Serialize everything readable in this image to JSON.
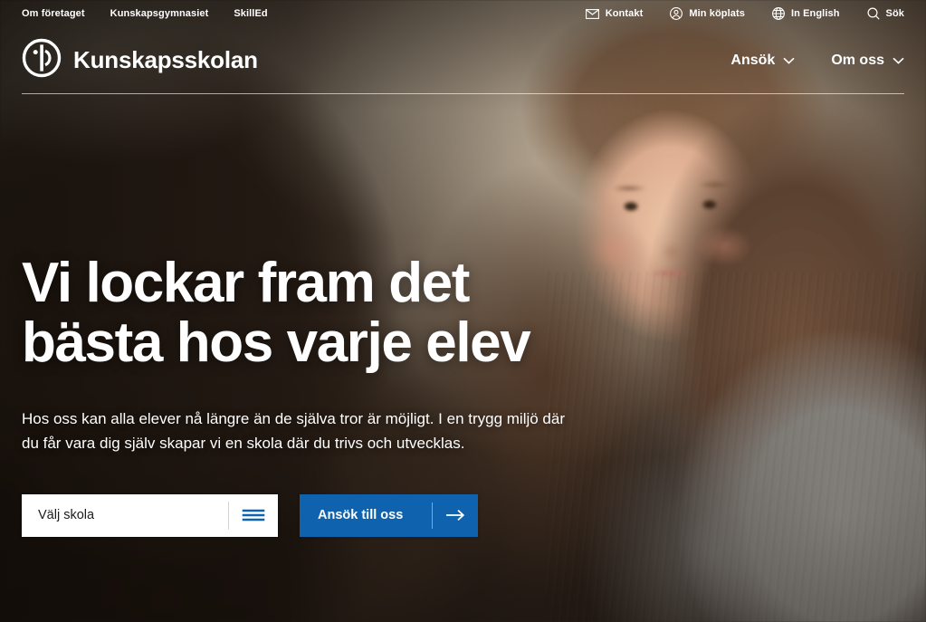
{
  "brand": {
    "name": "Kunskapsskolan",
    "logo_icon": "kunskapsskolan-circle-logo-icon"
  },
  "utility_bar": {
    "left_links": [
      {
        "label": "Om företaget"
      },
      {
        "label": "Kunskapsgymnasiet"
      },
      {
        "label": "SkillEd"
      }
    ],
    "right_links": [
      {
        "label": "Kontakt",
        "icon": "envelope-icon"
      },
      {
        "label": "Min köplats",
        "icon": "user-circle-icon"
      },
      {
        "label": "In English",
        "icon": "globe-icon"
      },
      {
        "label": "Sök",
        "icon": "search-icon"
      }
    ]
  },
  "main_nav": {
    "items": [
      {
        "label": "Ansök",
        "icon": "chevron-down-icon"
      },
      {
        "label": "Om oss",
        "icon": "chevron-down-icon"
      }
    ]
  },
  "hero": {
    "headline": "Vi lockar fram det bästa hos varje elev",
    "paragraph": "Hos oss kan alla elever nå längre än de själva tror är möjligt. I en trygg miljö där du får vara dig själv skapar vi en skola där du trivs och utvecklas.",
    "school_select": {
      "value": "Välj skola",
      "icon": "hamburger-list-icon"
    },
    "apply_button": {
      "label": "Ansök till oss",
      "icon": "arrow-right-icon"
    }
  },
  "colors": {
    "accent_blue": "#0f63ae",
    "text_on_image": "#ffffff",
    "field_background": "#ffffff"
  }
}
